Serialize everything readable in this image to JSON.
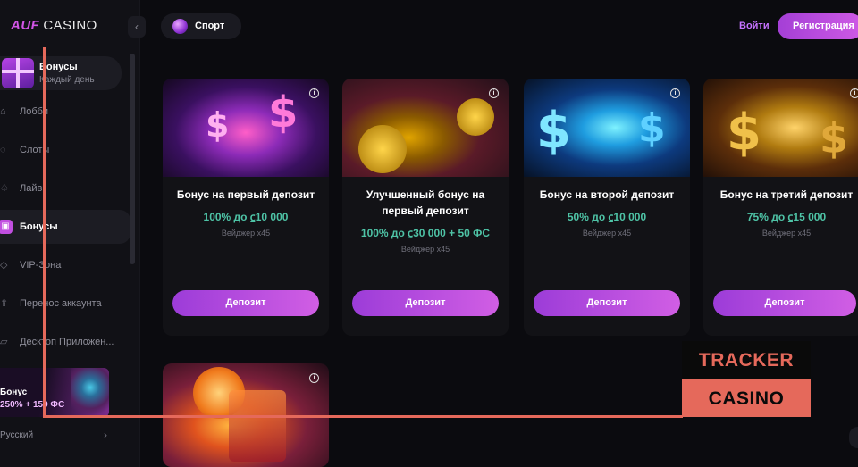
{
  "logo": {
    "brand": "AUF",
    "casino": "CASINO"
  },
  "sidebar": {
    "collapse_icon": "‹",
    "bonus_pill": {
      "title": "Бонусы",
      "subtitle": "Каждый день"
    },
    "items": [
      {
        "label": "Лобби",
        "icon": "home-icon",
        "glyph": "⌂",
        "active": false
      },
      {
        "label": "Слоты",
        "icon": "slots-icon",
        "glyph": "◌",
        "active": false
      },
      {
        "label": "Лайв",
        "icon": "spade-icon",
        "glyph": "♤",
        "active": false
      },
      {
        "label": "Бонусы",
        "icon": "gift-icon",
        "glyph": "▣",
        "active": true
      },
      {
        "label": "VIP-Зона",
        "icon": "diamond-icon",
        "glyph": "◇",
        "active": false
      },
      {
        "label": "Перенос аккаунта",
        "icon": "transfer-icon",
        "glyph": "⇪",
        "active": false
      },
      {
        "label": "Десктоп Приложен...",
        "icon": "desktop-icon",
        "glyph": "▱",
        "active": false
      }
    ],
    "promo": {
      "line1": "Бонус",
      "line2": "250% + 150 ФС"
    },
    "language": {
      "label": "Русский",
      "chevron": "›"
    }
  },
  "header": {
    "sport_label": "Спорт",
    "login_label": "Войти",
    "register_label": "Регистрация"
  },
  "cards": [
    {
      "title": "Бонус на первый депозит",
      "amount": "100% до  ⃀10 000",
      "wager": "Вейджер x45",
      "button": "Депозит",
      "info": "i"
    },
    {
      "title": "Улучшенный бонус на первый депозит",
      "amount": "100% до  ⃀30 000 + 50 ФС",
      "wager": "Вейджер x45",
      "button": "Депозит",
      "info": "i"
    },
    {
      "title": "Бонус на второй депозит",
      "amount": "50% до  ⃀10 000",
      "wager": "Вейджер x45",
      "button": "Депозит",
      "info": "i"
    },
    {
      "title": "Бонус на третий депозит",
      "amount": "75% до  ⃀15 000",
      "wager": "Вейджер x45",
      "button": "Депозит",
      "info": "i"
    },
    {
      "info": "i"
    }
  ],
  "watermark": {
    "line1": "TRACKER",
    "line2": "CASINO"
  },
  "colors": {
    "accent": "#c14fe0",
    "amount": "#4ec3a6",
    "watermark": "#e5695b",
    "background": "#0b0b0f"
  }
}
